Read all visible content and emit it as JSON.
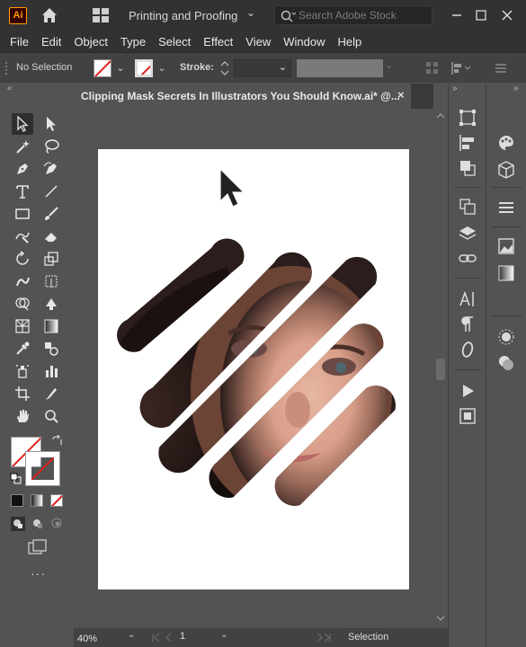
{
  "app": {
    "logo": "Ai",
    "workspace": "Printing and Proofing",
    "search_placeholder": "Search Adobe Stock"
  },
  "menu": [
    "File",
    "Edit",
    "Object",
    "Type",
    "Select",
    "Effect",
    "View",
    "Window",
    "Help"
  ],
  "control_bar": {
    "selection_status": "No Selection",
    "stroke_label": "Stroke:"
  },
  "document": {
    "tab_title": "Clipping Mask Secrets In Illustrators You Should Know.ai* @..."
  },
  "status_bar": {
    "zoom": "40%",
    "artboard_number": "1",
    "tool_status": "Selection"
  },
  "colors": {
    "fill": "#ffffff",
    "stroke": "none",
    "accent_logo": "#ff9a00"
  },
  "icons": {
    "left_toolbar": [
      "selection-tool-icon",
      "direct-selection-tool-icon",
      "magic-wand-icon",
      "lasso-icon",
      "pen-tool-icon",
      "curvature-tool-icon",
      "type-tool-icon",
      "line-segment-icon",
      "rectangle-tool-icon",
      "paintbrush-icon",
      "shaper-tool-icon",
      "eraser-icon",
      "rotate-tool-icon",
      "scale-tool-icon",
      "warp-tool-icon",
      "free-transform-icon",
      "shape-builder-icon",
      "live-paint-icon",
      "perspective-grid-icon",
      "gradient-tool-icon",
      "eyedropper-icon",
      "blend-tool-icon",
      "symbol-sprayer-icon",
      "column-graph-icon",
      "artboard-tool-icon",
      "slice-tool-icon",
      "hand-tool-icon",
      "zoom-tool-icon"
    ]
  }
}
